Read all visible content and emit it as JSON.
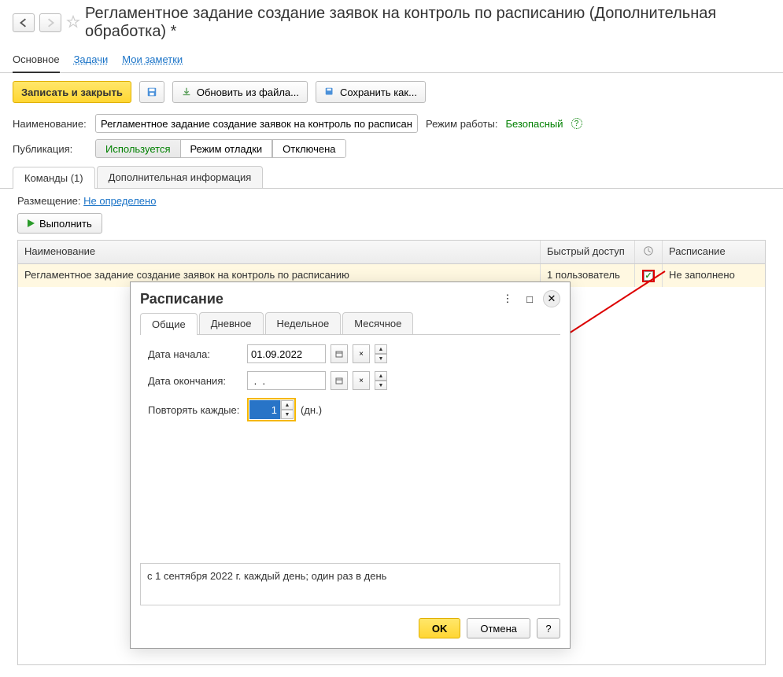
{
  "header": {
    "title": "Регламентное задание создание заявок на контроль по расписанию (Дополнительная обработка) *"
  },
  "nav": {
    "main": "Основное",
    "tasks": "Задачи",
    "notes": "Мои заметки"
  },
  "toolbar": {
    "save_close": "Записать и закрыть",
    "update_file": "Обновить из файла...",
    "save_as": "Сохранить как..."
  },
  "form": {
    "name_label": "Наименование:",
    "name_value": "Регламентное задание создание заявок на контроль по расписанию",
    "mode_label": "Режим работы:",
    "mode_value": "Безопасный",
    "pub_label": "Публикация:",
    "pub_used": "Используется",
    "pub_debug": "Режим отладки",
    "pub_off": "Отключена"
  },
  "tabs": {
    "commands": "Команды (1)",
    "addinfo": "Дополнительная информация"
  },
  "placement": {
    "label": "Размещение:",
    "value": "Не определено"
  },
  "exec_btn": "Выполнить",
  "table": {
    "col_name": "Наименование",
    "col_access": "Быстрый доступ",
    "col_schedule": "Расписание",
    "row_name": "Регламентное задание создание заявок на контроль по расписанию",
    "row_access": "1 пользователь",
    "row_schedule": "Не заполнено"
  },
  "dialog": {
    "title": "Расписание",
    "tabs": {
      "general": "Общие",
      "daily": "Дневное",
      "weekly": "Недельное",
      "monthly": "Месячное"
    },
    "start_label": "Дата начала:",
    "start_value": "01.09.2022",
    "end_label": "Дата окончания:",
    "end_value": " .  .    ",
    "repeat_label": "Повторять каждые:",
    "repeat_value": "1",
    "repeat_unit": "(дн.)",
    "summary": "с 1 сентября 2022 г. каждый день; один раз в день",
    "ok": "OK",
    "cancel": "Отмена",
    "help": "?"
  }
}
